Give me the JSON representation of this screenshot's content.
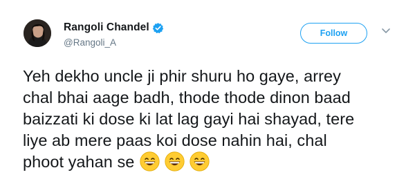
{
  "user": {
    "display_name": "Rangoli Chandel",
    "handle": "@Rangoli_A",
    "verified": true,
    "avatar_icon": "profile-photo-icon"
  },
  "actions": {
    "follow_label": "Follow",
    "more_icon": "chevron-down-icon"
  },
  "tweet": {
    "text_lines": [
      "Yeh dekho uncle ji phir shuru ho gaye, arrey",
      "chal bhai aage badh, thode thode dinon baad",
      "baizzati ki dose ki lat lag gayi hai shayad, tere",
      "liye ab mere paas koi dose nahin hai, chal",
      "phoot yahan se"
    ],
    "emojis": [
      "grinning-face-icon",
      "grinning-face-icon",
      "grinning-face-icon"
    ]
  },
  "colors": {
    "accent": "#1da1f2",
    "text": "#14171a",
    "muted": "#657786",
    "emoji_yellow": "#ffcc33"
  }
}
